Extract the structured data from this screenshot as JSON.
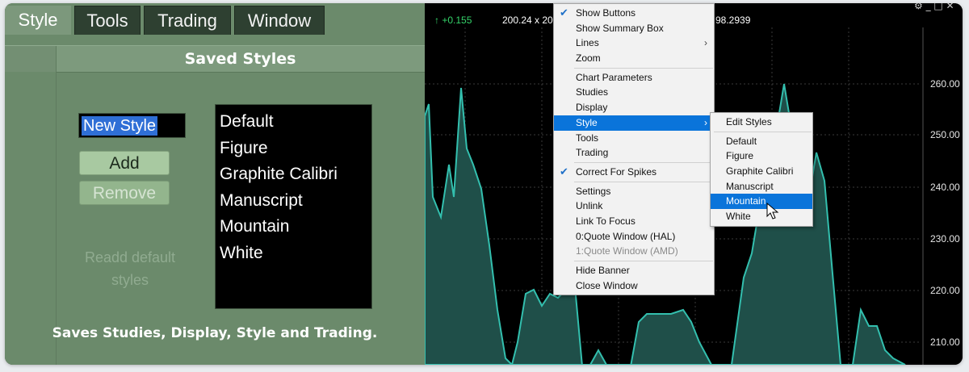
{
  "tabs": [
    {
      "label": "Style",
      "active": true
    },
    {
      "label": "Tools",
      "active": false
    },
    {
      "label": "Trading",
      "active": false
    },
    {
      "label": "Window",
      "active": false
    }
  ],
  "panel": {
    "title": "Saved Styles",
    "name_input_value": "New Style",
    "add_label": "Add",
    "remove_label": "Remove",
    "readd_line1": "Readd default",
    "readd_line2": "styles",
    "styles": [
      "Default",
      "Figure",
      "Graphite Calibri",
      "Manuscript",
      "Mountain",
      "White"
    ],
    "footer": "Saves Studies, Display, Style and Trading."
  },
  "chart": {
    "change": "↑ +0.155",
    "quote_left": "200.24 x 20",
    "quote_right": "98.2939",
    "y_axis_labels": [
      "260.00",
      "250.00",
      "240.00",
      "230.00",
      "220.00",
      "210.00"
    ],
    "line_color": "#33bfae",
    "fill_color": "#1f4f49"
  },
  "context_menu": {
    "items": [
      {
        "label": "Show Buttons",
        "checked": true
      },
      {
        "label": "Show Summary Box"
      },
      {
        "label": "Lines",
        "submenu": true
      },
      {
        "label": "Zoom"
      },
      {
        "separator": true
      },
      {
        "label": "Chart Parameters"
      },
      {
        "label": "Studies"
      },
      {
        "label": "Display"
      },
      {
        "label": "Style",
        "submenu": true,
        "highlighted": true
      },
      {
        "label": "Tools"
      },
      {
        "label": "Trading"
      },
      {
        "separator": true
      },
      {
        "label": "Correct For Spikes",
        "checked": true
      },
      {
        "separator": true
      },
      {
        "label": "Settings"
      },
      {
        "label": "Unlink"
      },
      {
        "label": "Link To Focus"
      },
      {
        "label": "0:Quote Window (HAL)"
      },
      {
        "label": "1:Quote Window (AMD)",
        "disabled": true
      },
      {
        "separator": true
      },
      {
        "label": "Hide Banner"
      },
      {
        "label": "Close Window"
      }
    ]
  },
  "style_submenu": {
    "items": [
      {
        "label": "Edit Styles"
      },
      {
        "separator": true
      },
      {
        "label": "Default"
      },
      {
        "label": "Figure"
      },
      {
        "label": "Graphite Calibri"
      },
      {
        "label": "Manuscript"
      },
      {
        "label": "Mountain",
        "highlighted": true
      },
      {
        "label": "White"
      }
    ]
  }
}
